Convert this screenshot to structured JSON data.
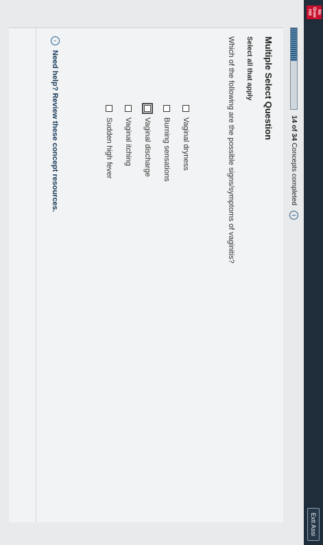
{
  "header": {
    "logo_text": "Mc Graw Hill",
    "exit_label": "Exit Assi"
  },
  "progress": {
    "completed": 14,
    "total": 34,
    "label_count": "14 of 34",
    "label_rest": "Concepts completed",
    "fraction": 0.41
  },
  "question": {
    "type": "Multiple Select Question",
    "instruction": "Select all that apply",
    "text": "Which of the following are the possible signs/symptoms of vaginitis?",
    "options": [
      {
        "label": "Vaginal dryness",
        "checked": false
      },
      {
        "label": "Burning sensations",
        "checked": false
      },
      {
        "label": "Vaginal discharge",
        "checked": false
      },
      {
        "label": "Vaginal itching",
        "checked": false
      },
      {
        "label": "Sudden high fever",
        "checked": false
      }
    ]
  },
  "help": {
    "text": "Need help? Review these concept resources."
  }
}
